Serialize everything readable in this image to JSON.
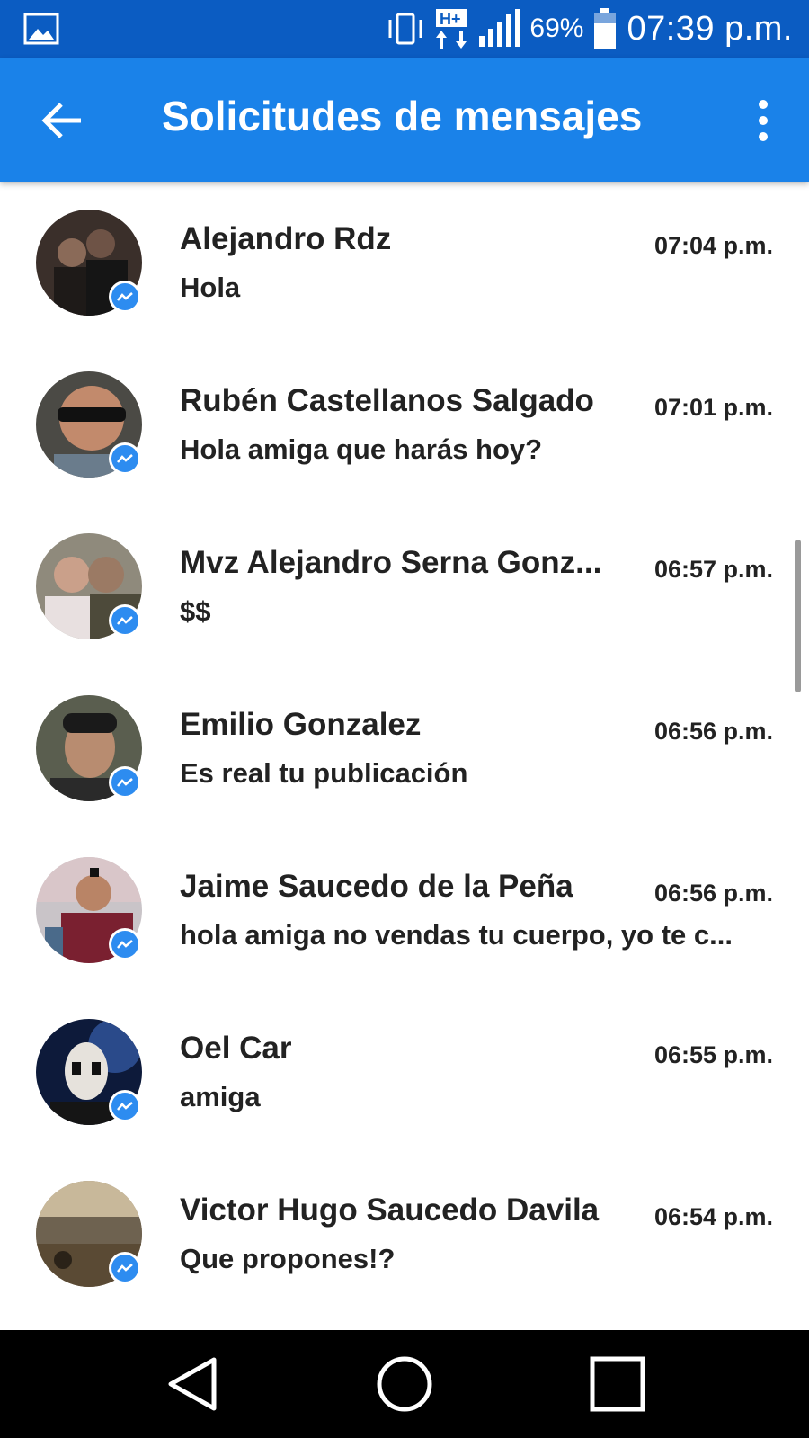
{
  "status_bar": {
    "battery_percent": "69%",
    "time": "07:39 p.m.",
    "icons": [
      "gallery-icon",
      "vibrate-icon",
      "hplus-data-icon",
      "signal-icon",
      "battery-icon"
    ]
  },
  "app_bar": {
    "title": "Solicitudes de mensajes",
    "back_icon": "arrow-left-icon",
    "more_icon": "more-vert-icon"
  },
  "messages": [
    {
      "name": "Alejandro Rdz",
      "time": "07:04 p.m.",
      "preview": "Hola"
    },
    {
      "name": "Rubén Castellanos Salgado",
      "time": "07:01 p.m.",
      "preview": "Hola amiga que harás hoy?"
    },
    {
      "name": "Mvz Alejandro Serna Gonz...",
      "time": "06:57 p.m.",
      "preview": "$$"
    },
    {
      "name": "Emilio Gonzalez",
      "time": "06:56 p.m.",
      "preview": "Es real tu publicación"
    },
    {
      "name": "Jaime Saucedo de la Peña",
      "time": "06:56 p.m.",
      "preview": "hola amiga no vendas tu cuerpo, yo te c..."
    },
    {
      "name": "Oel Car",
      "time": "06:55 p.m.",
      "preview": "amiga"
    },
    {
      "name": "Victor Hugo Saucedo Davila",
      "time": "06:54 p.m.",
      "preview": "Que propones!?"
    }
  ],
  "nav_bar": {
    "icons": [
      "back-triangle-icon",
      "home-circle-icon",
      "recents-square-icon"
    ]
  },
  "colors": {
    "status_bar": "#0b5cc2",
    "app_bar": "#1a82e9",
    "badge": "#2d8cf0"
  }
}
